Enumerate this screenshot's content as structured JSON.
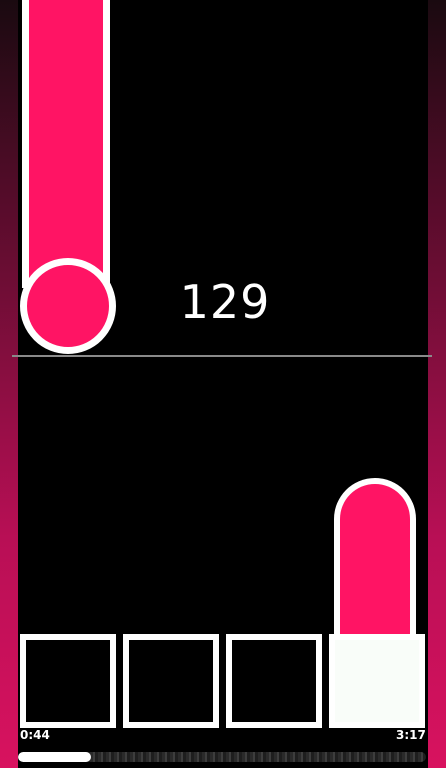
{
  "game": {
    "score": "129",
    "accent_color": "#ff1464",
    "lanes": [
      {
        "active": false
      },
      {
        "active": false
      },
      {
        "active": false
      },
      {
        "active": true
      }
    ]
  },
  "playback": {
    "current_time": "0:44",
    "total_time": "3:17",
    "progress_fraction": 0.18
  }
}
